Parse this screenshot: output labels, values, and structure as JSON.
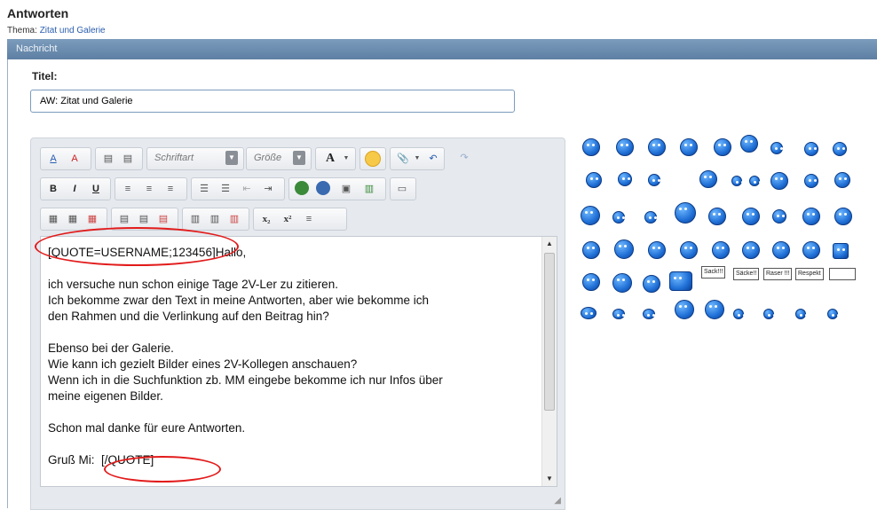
{
  "page": {
    "title": "Antworten",
    "thema_label": "Thema:",
    "thema_link": "Zitat und Galerie"
  },
  "bar": {
    "label": "Nachricht"
  },
  "titel": {
    "label": "Titel:",
    "value": "AW: Zitat und Galerie"
  },
  "toolbar": {
    "font_label": "Schriftart",
    "size_label": "Größe"
  },
  "message": {
    "text": "[QUOTE=USERNAME;123456]Hallo,\n\nich versuche nun schon einige Tage 2V-Ler zu zitieren.\nIch bekomme zwar den Text in meine Antworten, aber wie bekomme ich\nden Rahmen und die Verlinkung auf den Beitrag hin?\n\nEbenso bei der Galerie.\nWie kann ich gezielt Bilder eines 2V-Kollegen anschauen?\nWenn ich in die Suchfunktion zb. MM eingebe bekomme ich nur Infos über\nmeine eigenen Bilder.\n\nSchon mal danke für eure Antworten.\n\nGruß Mi:  [/QUOTE]"
  },
  "smilies": {
    "signs": [
      "Sack!!!",
      "Säcke!!",
      "Raser !!!",
      "Respekt"
    ]
  },
  "colors": {
    "bar": "#5d7fa3",
    "link": "#2a5db0",
    "annotation": "#e21b1b",
    "smiley": "#1f6fd6"
  }
}
